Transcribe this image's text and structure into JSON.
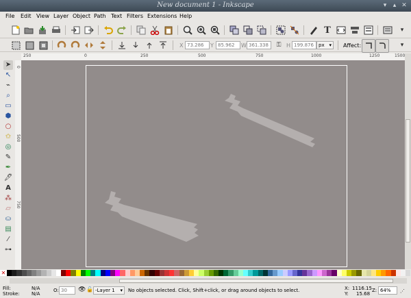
{
  "window": {
    "title": "New document 1 - Inkscape"
  },
  "menubar": [
    "File",
    "Edit",
    "View",
    "Layer",
    "Object",
    "Path",
    "Text",
    "Filters",
    "Extensions",
    "Help"
  ],
  "commands_toolbar": [
    "new-icon",
    "open-icon",
    "save-icon",
    "print-icon",
    "import-icon",
    "export-icon",
    "undo-icon",
    "redo-icon",
    "copy-icon",
    "cut-icon",
    "paste-icon",
    "zoom-selection-icon",
    "zoom-drawing-icon",
    "zoom-page-icon",
    "duplicate-icon",
    "clone-icon",
    "unlink-clone-icon",
    "group-icon",
    "ungroup-icon",
    "fill-stroke-icon",
    "text-font-icon",
    "xml-editor-icon",
    "align-icon",
    "preferences-icon"
  ],
  "controls_toolbar": {
    "x_label": "X",
    "x_value": "73.286",
    "y_label": "Y",
    "y_value": "85.962",
    "w_label": "W",
    "w_value": "361.338",
    "h_label": "H",
    "h_value": "199.876",
    "unit": "px",
    "affect_label": "Affect:"
  },
  "ruler": {
    "ticks": [
      "250",
      "0",
      "250",
      "500",
      "750",
      "1000",
      "1250",
      "1500"
    ]
  },
  "vruler": {
    "ticks": [
      "0",
      "500",
      "750"
    ]
  },
  "toolbox": [
    "select-icon",
    "node-icon",
    "tweak-icon",
    "zoom-icon",
    "rect-icon",
    "3dbox-icon",
    "ellipse-icon",
    "star-icon",
    "spiral-icon",
    "pencil-icon",
    "pen-icon",
    "calligraphy-icon",
    "text-icon",
    "spray-icon",
    "eraser-icon",
    "bucket-icon",
    "gradient-icon",
    "dropper-icon",
    "connector-icon"
  ],
  "palette": [
    "#000000",
    "#1a1a1a",
    "#333333",
    "#4d4d4d",
    "#666666",
    "#808080",
    "#999999",
    "#b3b3b3",
    "#cccccc",
    "#e6e6e6",
    "#ffffff",
    "#800000",
    "#ff0000",
    "#808000",
    "#ffff00",
    "#008000",
    "#00ff00",
    "#008080",
    "#00ffff",
    "#000080",
    "#0000ff",
    "#800080",
    "#ff00ff",
    "#ff6666",
    "#ffcccc",
    "#ff9966",
    "#ffcc99",
    "#cc6600",
    "#663300",
    "#330000",
    "#660000",
    "#993333",
    "#cc3333",
    "#ff3333",
    "#cc6666",
    "#996633",
    "#cc9933",
    "#ffcc33",
    "#ffff99",
    "#ccff66",
    "#99cc33",
    "#669900",
    "#336600",
    "#003300",
    "#006633",
    "#339966",
    "#66cc99",
    "#99ffcc",
    "#66ffff",
    "#33cccc",
    "#009999",
    "#006666",
    "#003333",
    "#336699",
    "#6699cc",
    "#99ccff",
    "#ccccff",
    "#9999ff",
    "#6666cc",
    "#333399",
    "#663399",
    "#9966cc",
    "#cc99ff",
    "#ff99ff",
    "#cc66cc",
    "#993399",
    "#660066",
    "#ffffcc",
    "#ffff66",
    "#cccc00",
    "#999900",
    "#666600",
    "#e6e6aa",
    "#d4d49a",
    "#ffe680",
    "#ffcc00",
    "#ff9900",
    "#ff6600",
    "#cc3300",
    "#ffe6e6",
    "#f2f2f2",
    "#d9d9d9"
  ],
  "status": {
    "fill_label": "Fill:",
    "fill_value": "N/A",
    "stroke_label": "Stroke:",
    "stroke_value": "N/A",
    "opacity_label": "O:",
    "opacity_value": "30",
    "layer": "-Layer 1",
    "message": "No objects selected. Click, Shift+click, or drag around objects to select.",
    "x_label": "X:",
    "x_value": "1116.15",
    "y_label": "Y:",
    "y_value": "15.68",
    "zoom_label": "Z:",
    "zoom_value": "64%"
  },
  "colors": {
    "canvas": "#928c8b",
    "tape": "#b4afae",
    "titlebar": "#4a5763"
  }
}
